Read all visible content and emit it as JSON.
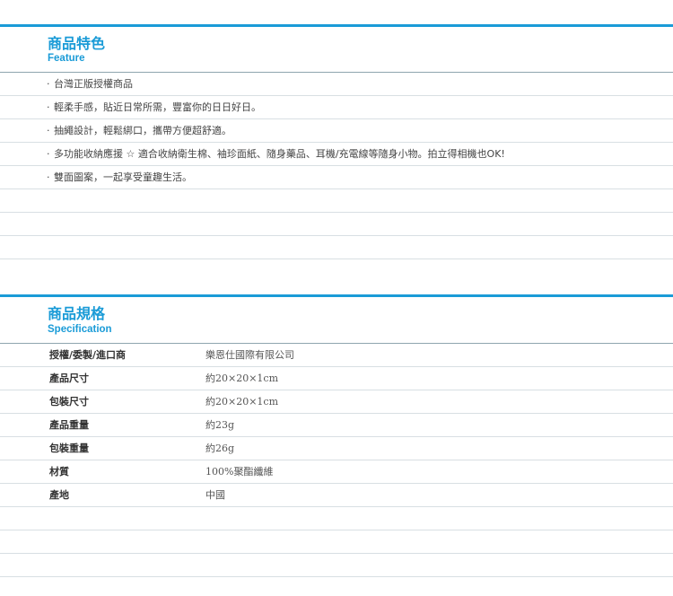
{
  "feature": {
    "title_zh": "商品特色",
    "title_en": "Feature",
    "bullet": "·",
    "items": [
      "台灣正版授權商品",
      "輕柔手感，貼近日常所需，豐富你的日日好日。",
      "抽繩設計，輕鬆綁口，攜帶方便超舒適。",
      "多功能收納應援 ☆ 適合收納衛生棉、袖珍面紙、隨身藥品、耳機/充電線等隨身小物。拍立得相機也OK!",
      "雙面圖案，一起享受童趣生活。"
    ]
  },
  "specification": {
    "title_zh": "商品規格",
    "title_en": "Specification",
    "rows": [
      {
        "label": "授權/委製/進口商",
        "value": "樂恩仕國際有限公司"
      },
      {
        "label": "產品尺寸",
        "value": "約20×20×1cm"
      },
      {
        "label": "包裝尺寸",
        "value": "約20×20×1cm"
      },
      {
        "label": "產品重量",
        "value": "約23g"
      },
      {
        "label": "包裝重量",
        "value": "約26g"
      },
      {
        "label": "材質",
        "value": "100%聚酯纖維"
      },
      {
        "label": "產地",
        "value": "中國"
      }
    ]
  },
  "colors": {
    "accent": "#1a9bd7",
    "divider": "#d8dfe3"
  }
}
